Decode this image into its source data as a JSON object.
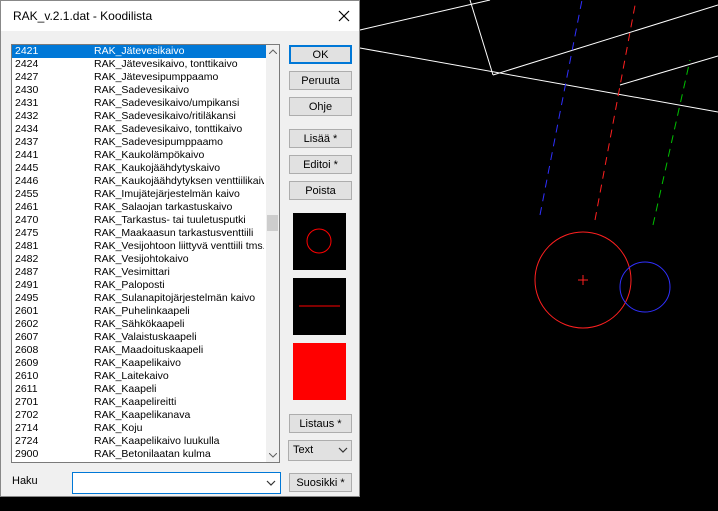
{
  "window": {
    "title": "RAK_v.2.1.dat - Koodilista"
  },
  "list": {
    "selected_index": 0,
    "items": [
      {
        "code": "2421",
        "name": "RAK_Jätevesikaivo"
      },
      {
        "code": "2424",
        "name": "RAK_Jätevesikaivo, tonttikaivo"
      },
      {
        "code": "2427",
        "name": "RAK_Jätevesipumppaamo"
      },
      {
        "code": "2430",
        "name": "RAK_Sadevesikaivo"
      },
      {
        "code": "2431",
        "name": "RAK_Sadevesikaivo/umpikansi"
      },
      {
        "code": "2432",
        "name": "RAK_Sadevesikaivo/ritiläkansi"
      },
      {
        "code": "2434",
        "name": "RAK_Sadevesikaivo, tonttikaivo"
      },
      {
        "code": "2437",
        "name": "RAK_Sadevesipumppaamo"
      },
      {
        "code": "2441",
        "name": "RAK_Kaukolämpökaivo"
      },
      {
        "code": "2445",
        "name": "RAK_Kaukojäähdytyskaivo"
      },
      {
        "code": "2446",
        "name": "RAK_Kaukojäähdytyksen venttiilikaivo"
      },
      {
        "code": "2455",
        "name": "RAK_Imujätejärjestelmän kaivo"
      },
      {
        "code": "2461",
        "name": "RAK_Salaojan tarkastuskaivo"
      },
      {
        "code": "2470",
        "name": "RAK_Tarkastus- tai tuuletusputki"
      },
      {
        "code": "2475",
        "name": "RAK_Maakaasun tarkastusventtiili"
      },
      {
        "code": "2481",
        "name": "RAK_Vesijohtoon liittyvä venttiili tms."
      },
      {
        "code": "2482",
        "name": "RAK_Vesijohtokaivo"
      },
      {
        "code": "2487",
        "name": "RAK_Vesimittari"
      },
      {
        "code": "2491",
        "name": "RAK_Paloposti"
      },
      {
        "code": "2495",
        "name": "RAK_Sulanapitojärjestelmän kaivo"
      },
      {
        "code": "2601",
        "name": "RAK_Puhelinkaapeli"
      },
      {
        "code": "2602",
        "name": "RAK_Sähkökaapeli"
      },
      {
        "code": "2607",
        "name": "RAK_Valaistuskaapeli"
      },
      {
        "code": "2608",
        "name": "RAK_Maadoituskaapeli"
      },
      {
        "code": "2609",
        "name": "RAK_Kaapelikaivo"
      },
      {
        "code": "2610",
        "name": "RAK_Laitekaivo"
      },
      {
        "code": "2611",
        "name": "RAK_Kaapeli"
      },
      {
        "code": "2701",
        "name": "RAK_Kaapelireitti"
      },
      {
        "code": "2702",
        "name": "RAK_Kaapelikanava"
      },
      {
        "code": "2714",
        "name": "RAK_Koju"
      },
      {
        "code": "2724",
        "name": "RAK_Kaapelikaivo luukulla"
      },
      {
        "code": "2900",
        "name": "RAK_Betonilaatan kulma"
      }
    ]
  },
  "buttons": {
    "ok": "OK",
    "cancel": "Peruuta",
    "help": "Ohje",
    "add": "Lisää *",
    "edit": "Editoi *",
    "delete": "Poista",
    "listing": "Listaus *",
    "favorites": "Suosikki *"
  },
  "text_select": {
    "value": "Text"
  },
  "search": {
    "label": "Haku",
    "value": ""
  },
  "colors": {
    "selection": "#0078d7",
    "symbol_red": "#ff0000",
    "cad_blue": "#3030ff",
    "cad_green": "#00c000"
  }
}
